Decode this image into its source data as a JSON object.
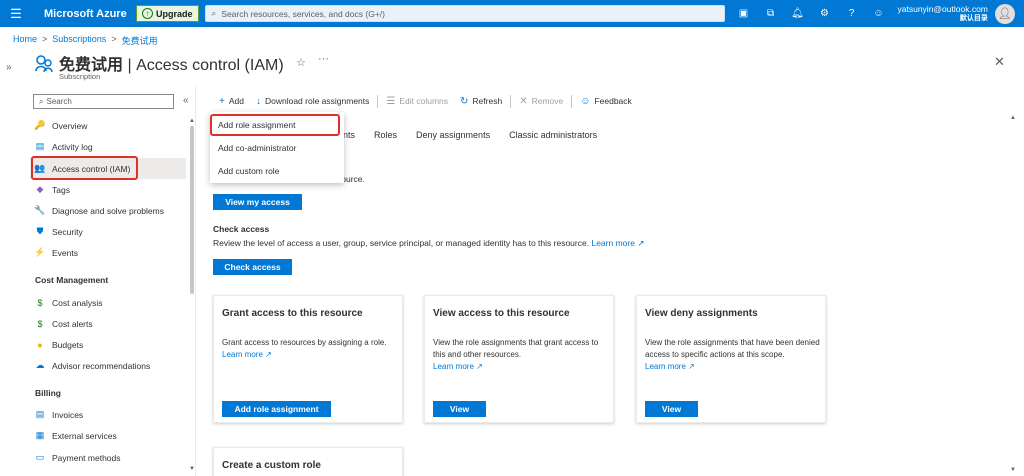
{
  "topbar": {
    "menu_icon": "hamburger-icon",
    "brand": "Microsoft Azure",
    "upgrade_label": "Upgrade",
    "search_placeholder": "Search resources, services, and docs (G+/)",
    "icons": [
      "cloud-shell-icon",
      "directory-filter-icon",
      "notifications-icon",
      "settings-icon",
      "help-icon",
      "feedback-icon"
    ],
    "account_email": "yatsunyin@outlook.com",
    "account_directory": "默认目录"
  },
  "breadcrumb": [
    "Home",
    "Subscriptions",
    "免费试用"
  ],
  "header": {
    "title_resource": "免费试用",
    "title_sep": " | ",
    "title_page": "Access control (IAM)",
    "subtitle": "Subscription",
    "star_icon": "☆",
    "more_icon": "···",
    "close_icon": "✕"
  },
  "sidebar": {
    "search_placeholder": "Search",
    "collapse_glyph": "«",
    "items": [
      {
        "label": "Overview",
        "icon": "key-icon",
        "glyph": "🔑",
        "color": "#e6b800"
      },
      {
        "label": "Activity log",
        "icon": "activity-log-icon",
        "glyph": "▤",
        "color": "#0078d4"
      },
      {
        "label": "Access control (IAM)",
        "icon": "people-icon",
        "glyph": "👥",
        "color": "#0078d4"
      },
      {
        "label": "Tags",
        "icon": "tag-icon",
        "glyph": "◆",
        "color": "#8661c5"
      },
      {
        "label": "Diagnose and solve problems",
        "icon": "wrench-icon",
        "glyph": "🔧",
        "color": "#605e5c"
      },
      {
        "label": "Security",
        "icon": "shield-icon",
        "glyph": "⛊",
        "color": "#0078d4"
      },
      {
        "label": "Events",
        "icon": "lightning-icon",
        "glyph": "⚡",
        "color": "#e6b800"
      }
    ],
    "sections": [
      {
        "title": "Cost Management",
        "items": [
          {
            "label": "Cost analysis",
            "icon": "cost-analysis-icon",
            "glyph": "$",
            "color": "#107c10"
          },
          {
            "label": "Cost alerts",
            "icon": "cost-alerts-icon",
            "glyph": "$",
            "color": "#107c10"
          },
          {
            "label": "Budgets",
            "icon": "budgets-icon",
            "glyph": "●",
            "color": "#e6b800"
          },
          {
            "label": "Advisor recommendations",
            "icon": "advisor-icon",
            "glyph": "☁",
            "color": "#0078d4"
          }
        ]
      },
      {
        "title": "Billing",
        "items": [
          {
            "label": "Invoices",
            "icon": "invoices-icon",
            "glyph": "▤",
            "color": "#0078d4"
          },
          {
            "label": "External services",
            "icon": "external-services-icon",
            "glyph": "▦",
            "color": "#0078d4"
          },
          {
            "label": "Payment methods",
            "icon": "payment-methods-icon",
            "glyph": "▭",
            "color": "#0078d4"
          }
        ]
      }
    ]
  },
  "commandbar": [
    {
      "label": "Add",
      "icon": "add-icon",
      "glyph": "+",
      "disabled": false
    },
    {
      "label": "Download role assignments",
      "icon": "download-icon",
      "glyph": "↓",
      "disabled": false
    },
    {
      "label": "Edit columns",
      "icon": "edit-columns-icon",
      "glyph": "☰",
      "disabled": true
    },
    {
      "label": "Refresh",
      "icon": "refresh-icon",
      "glyph": "↻",
      "disabled": false
    },
    {
      "label": "Remove",
      "icon": "remove-icon",
      "glyph": "✕",
      "disabled": true
    },
    {
      "label": "Feedback",
      "icon": "feedback-icon",
      "glyph": "☺",
      "disabled": false
    }
  ],
  "tabs": [
    "nts",
    "Roles",
    "Deny assignments",
    "Classic administrators"
  ],
  "dropdown": [
    "Add role assignment",
    "Add co-administrator",
    "Add custom role"
  ],
  "main": {
    "my_access_fragment": "source.",
    "view_my_access": "View my access",
    "check_access_title": "Check access",
    "check_access_desc": "Review the level of access a user, group, service principal, or managed identity has to this resource.",
    "learn_more": "Learn more",
    "check_access_button": "Check access",
    "cards": [
      {
        "title": "Grant access to this resource",
        "desc": "Grant access to resources by assigning a role.",
        "learn_more": "Learn more",
        "button": "Add role assignment"
      },
      {
        "title": "View access to this resource",
        "desc": "View the role assignments that grant access to this and other resources.",
        "learn_more": "Learn more",
        "button": "View"
      },
      {
        "title": "View deny assignments",
        "desc": "View the role assignments that have been denied access to specific actions at this scope.",
        "learn_more": "Learn more",
        "button": "View"
      },
      {
        "title": "Create a custom role"
      }
    ]
  },
  "colors": {
    "accent": "#0078d4",
    "highlight": "#e0302a"
  }
}
